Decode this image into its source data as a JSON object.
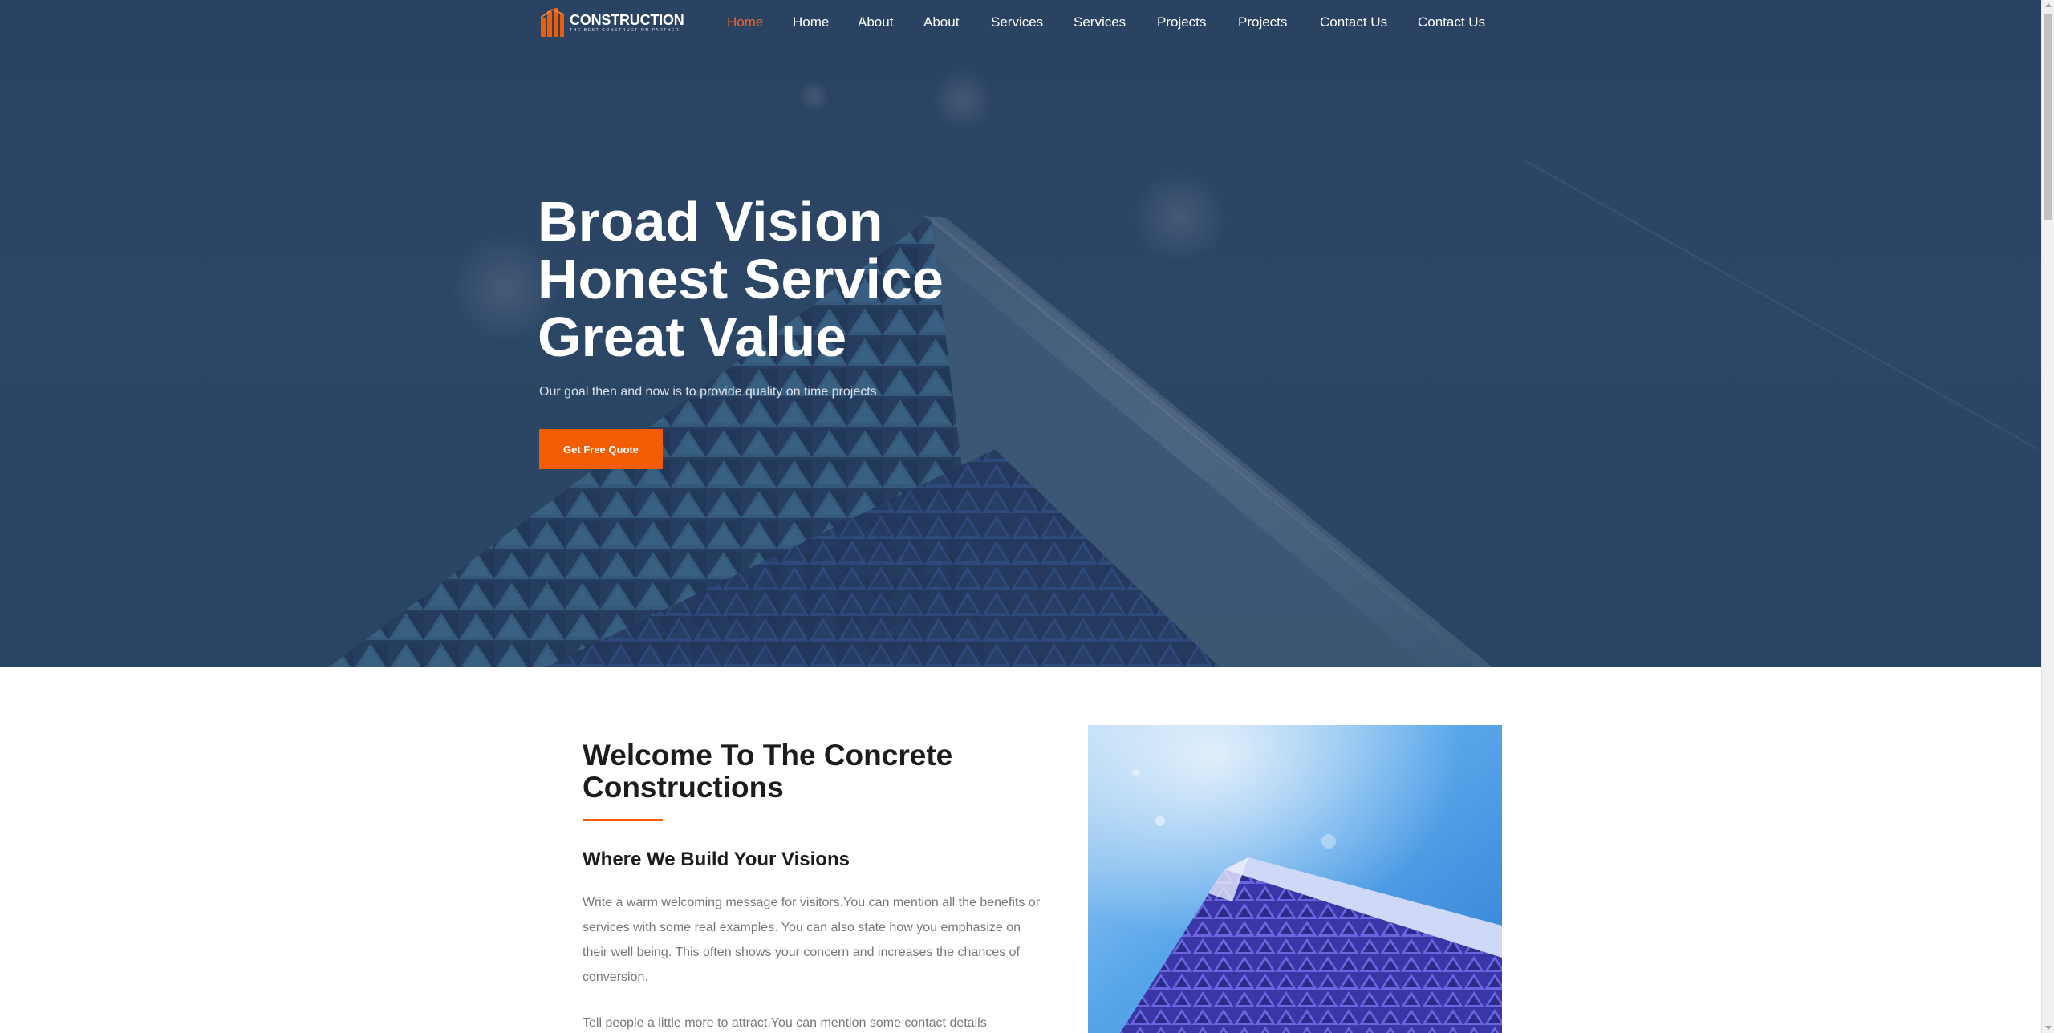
{
  "brand": {
    "name": "CONSTRUCTION",
    "tagline": "THE BEST CONSTRUCTION PARTNER",
    "logo_icon": "building-bars-icon",
    "accent_color": "#f25c05"
  },
  "nav": {
    "items": [
      {
        "label": "Home",
        "active": true
      },
      {
        "label": "Home",
        "active": false
      },
      {
        "label": "About",
        "active": false
      },
      {
        "label": "About",
        "active": false
      },
      {
        "label": "Services",
        "active": false
      },
      {
        "label": "Services",
        "active": false
      },
      {
        "label": "Projects",
        "active": false
      },
      {
        "label": "Projects",
        "active": false
      },
      {
        "label": "Contact Us",
        "active": false
      },
      {
        "label": "Contact Us",
        "active": false
      }
    ]
  },
  "hero": {
    "title_lines": [
      "Broad Vision",
      "Honest Service",
      "Great Value"
    ],
    "subtitle": "Our goal then and now is to provide quality on time projects",
    "cta_label": "Get Free Quote"
  },
  "welcome": {
    "title": "Welcome To The Concrete Constructions",
    "subtitle": "Where We Build Your Visions",
    "paragraph1": "Write a warm welcoming message for visitors.You can mention all the benefits or services with some real examples. You can also state how you emphasize on their well being. This often shows your concern and increases the chances of conversion.",
    "paragraph2": "Tell people a little more to attract.You can mention some contact details"
  }
}
